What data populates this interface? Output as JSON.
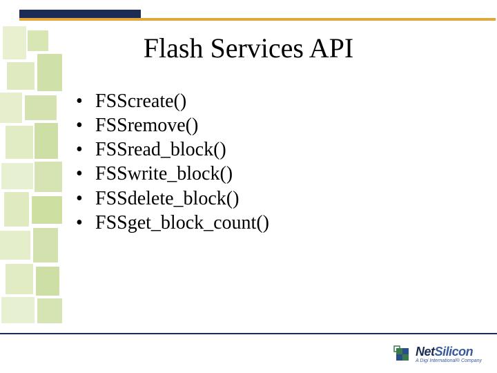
{
  "title": "Flash Services API",
  "bullets": [
    "FSScreate()",
    "FSSremove()",
    "FSSread_block()",
    "FSSwrite_block()",
    "FSSdelete_block()",
    "FSSget_block_count()"
  ],
  "brand": {
    "name_part1": "Net",
    "name_part2": "Silicon",
    "tagline": "A Digi International® Company"
  },
  "decor_blocks": [
    {
      "l": 4,
      "t": 0,
      "w": 34,
      "h": 48,
      "c": "#e9f0d0"
    },
    {
      "l": 40,
      "t": 6,
      "w": 30,
      "h": 30,
      "c": "#d8e6b4"
    },
    {
      "l": 10,
      "t": 52,
      "w": 40,
      "h": 40,
      "c": "#dfeac0"
    },
    {
      "l": 54,
      "t": 40,
      "w": 36,
      "h": 54,
      "c": "#cfe0a8"
    },
    {
      "l": 0,
      "t": 96,
      "w": 32,
      "h": 44,
      "c": "#e6eecd"
    },
    {
      "l": 36,
      "t": 100,
      "w": 46,
      "h": 36,
      "c": "#d4e2b0"
    },
    {
      "l": 8,
      "t": 144,
      "w": 40,
      "h": 48,
      "c": "#e1ebc4"
    },
    {
      "l": 50,
      "t": 140,
      "w": 34,
      "h": 52,
      "c": "#cddfa4"
    },
    {
      "l": 2,
      "t": 198,
      "w": 46,
      "h": 38,
      "c": "#e8f0d2"
    },
    {
      "l": 50,
      "t": 196,
      "w": 40,
      "h": 44,
      "c": "#d6e3b3"
    },
    {
      "l": 6,
      "t": 240,
      "w": 36,
      "h": 50,
      "c": "#dfeac0"
    },
    {
      "l": 46,
      "t": 246,
      "w": 44,
      "h": 40,
      "c": "#cde0a2"
    },
    {
      "l": 0,
      "t": 296,
      "w": 44,
      "h": 42,
      "c": "#e5eeca"
    },
    {
      "l": 48,
      "t": 292,
      "w": 36,
      "h": 50,
      "c": "#d2e1ad"
    },
    {
      "l": 8,
      "t": 344,
      "w": 40,
      "h": 44,
      "c": "#e1ebc4"
    },
    {
      "l": 52,
      "t": 348,
      "w": 34,
      "h": 42,
      "c": "#cddfa4"
    },
    {
      "l": 2,
      "t": 392,
      "w": 48,
      "h": 38,
      "c": "#e8f0d2"
    },
    {
      "l": 54,
      "t": 394,
      "w": 36,
      "h": 36,
      "c": "#d6e3b3"
    }
  ]
}
